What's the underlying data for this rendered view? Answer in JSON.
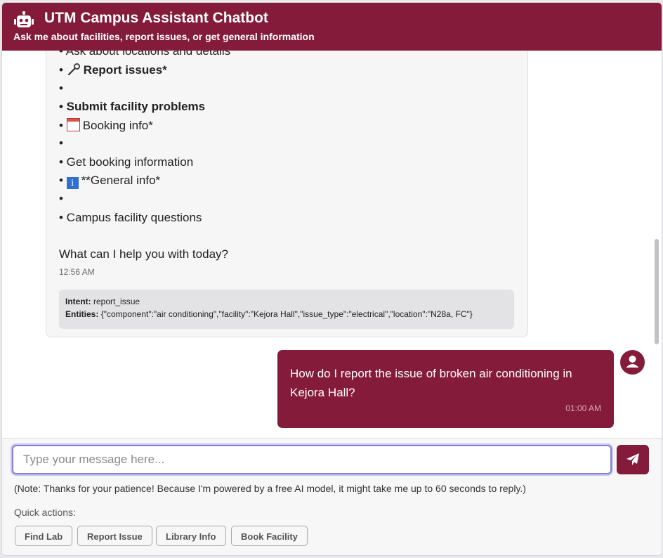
{
  "header": {
    "title": "UTM Campus Assistant Chatbot",
    "subtitle": "Ask me about facilities, report issues, or get general information",
    "icon": "robot-icon"
  },
  "chat": {
    "bot_message": {
      "lines": [
        "• Ask about locations and details",
        "Report issues*",
        "•",
        "• Submit facility problems",
        "Booking info*",
        "•",
        "• Get booking information",
        "**General info*",
        "•",
        "• Campus facility questions",
        "What can I help you with today?"
      ],
      "timestamp": "12:56 AM",
      "intent_label": "Intent:",
      "intent_value": "report_issue",
      "entities_label": "Entities:",
      "entities_value": "{\"component\":\"air conditioning\",\"facility\":\"Kejora Hall\",\"issue_type\":\"electrical\",\"location\":\"N28a, FC\"}"
    },
    "user_message": {
      "text": "How do I report the issue of broken air conditioning in Kejora Hall?",
      "timestamp": "01:00 AM"
    }
  },
  "input": {
    "placeholder": "Type your message here...",
    "value": ""
  },
  "note": "(Note: Thanks for your patience! Because I'm powered by a free AI model, it might take me up to 60 seconds to reply.)",
  "quick_actions": {
    "label": "Quick actions:",
    "buttons": [
      "Find Lab",
      "Report Issue",
      "Library Info",
      "Book Facility"
    ]
  },
  "colors": {
    "brand": "#841b3a",
    "bubble_bg": "#f6f6f7",
    "meta_bg": "#e3e3e6"
  }
}
